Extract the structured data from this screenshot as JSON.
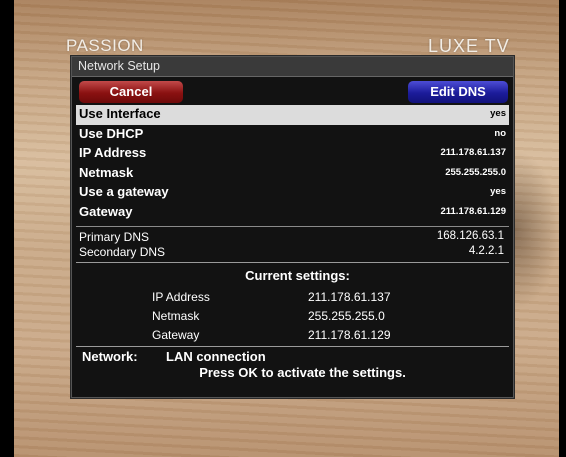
{
  "brand": {
    "left": "PASSION",
    "right": "LUXE TV"
  },
  "dialog": {
    "title": "Network Setup",
    "cancel_label": "Cancel",
    "edit_dns_label": "Edit DNS",
    "fields": [
      {
        "label": "Use Interface",
        "value": "yes",
        "selected": true
      },
      {
        "label": "Use DHCP",
        "value": "no"
      },
      {
        "label": "IP Address",
        "value": "211.178.61.137"
      },
      {
        "label": "Netmask",
        "value": "255.255.255.0"
      },
      {
        "label": "Use a gateway",
        "value": "yes"
      },
      {
        "label": "Gateway",
        "value": "211.178.61.129"
      }
    ],
    "dns": [
      {
        "label": "Primary DNS",
        "value": "168.126.63.1"
      },
      {
        "label": "Secondary DNS",
        "value": "4.2.2.1"
      }
    ],
    "current": {
      "title": "Current settings:",
      "rows": [
        {
          "label": "IP Address",
          "value": "211.178.61.137"
        },
        {
          "label": "Netmask",
          "value": "255.255.255.0"
        },
        {
          "label": "Gateway",
          "value": "211.178.61.129"
        }
      ]
    },
    "network": {
      "label": "Network:",
      "value": "LAN connection"
    },
    "hint": "Press OK to activate the settings."
  }
}
